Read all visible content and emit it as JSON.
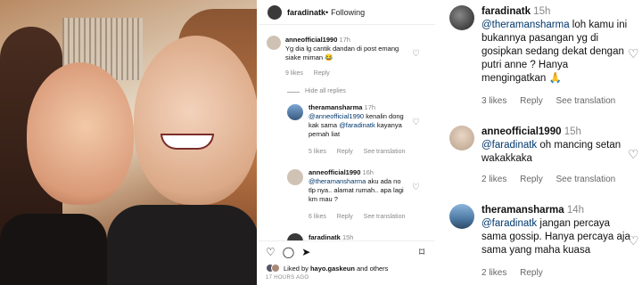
{
  "post": {
    "author": "faradinatk",
    "separator": " • ",
    "follow_status": "Following",
    "liked_by_prefix": "Liked by ",
    "liked_by_user": "hayo.gaskeun",
    "liked_by_suffix": " and others",
    "time_ago": "17 HOURS AGO"
  },
  "middle_comments": {
    "c1": {
      "user": "anneofficial1990",
      "time": "17h",
      "text": "Yg dia lg cantik dandan di post emang siake miman 😂",
      "likes": "9 likes",
      "reply": "Reply"
    },
    "hide_replies": "Hide all replies",
    "c2": {
      "user": "theramansharma",
      "time": "17h",
      "mention": "@anneofficial1990",
      "text": " kenalin dong kak sama ",
      "mention2": "@faradinatk",
      "text2": " kayanya pernah liat",
      "likes": "5 likes",
      "reply": "Reply",
      "see_translation": "See translation"
    },
    "c3": {
      "user": "anneofficial1990",
      "time": "16h",
      "mention": "@theramansharma",
      "text": " aku ada no tlp nya.. alamat rumah.. apa lagi km mau ?",
      "likes": "6 likes",
      "reply": "Reply",
      "see_translation": "See translation"
    },
    "c4": {
      "user": "faradinatk",
      "time": "15h"
    }
  },
  "right_comments": {
    "c1": {
      "user": "faradinatk",
      "time": "15h",
      "mention": "@theramansharma",
      "text": " loh kamu ini bukannya pasangan yg di gosipkan sedang dekat dengan putri anne ? Hanya mengingatkan 🙏",
      "likes": "3 likes",
      "reply": "Reply",
      "see_translation": "See translation"
    },
    "c2": {
      "user": "anneofficial1990",
      "time": "15h",
      "mention": "@faradinatk",
      "text": " oh mancing setan wakakkaka",
      "likes": "2 likes",
      "reply": "Reply",
      "see_translation": "See translation"
    },
    "c3": {
      "user": "theramansharma",
      "time": "14h",
      "mention": "@faradinatk",
      "text": " jangan percaya sama gossip. Hanya percaya aja sama yang maha kuasa",
      "likes": "2 likes",
      "reply": "Reply"
    }
  },
  "icons": {
    "heart": "♡",
    "comment": "◯",
    "share": "➤",
    "bookmark": "⌑",
    "check": "✔"
  },
  "colors": {
    "mention": "#00376b",
    "meta": "#888888"
  }
}
